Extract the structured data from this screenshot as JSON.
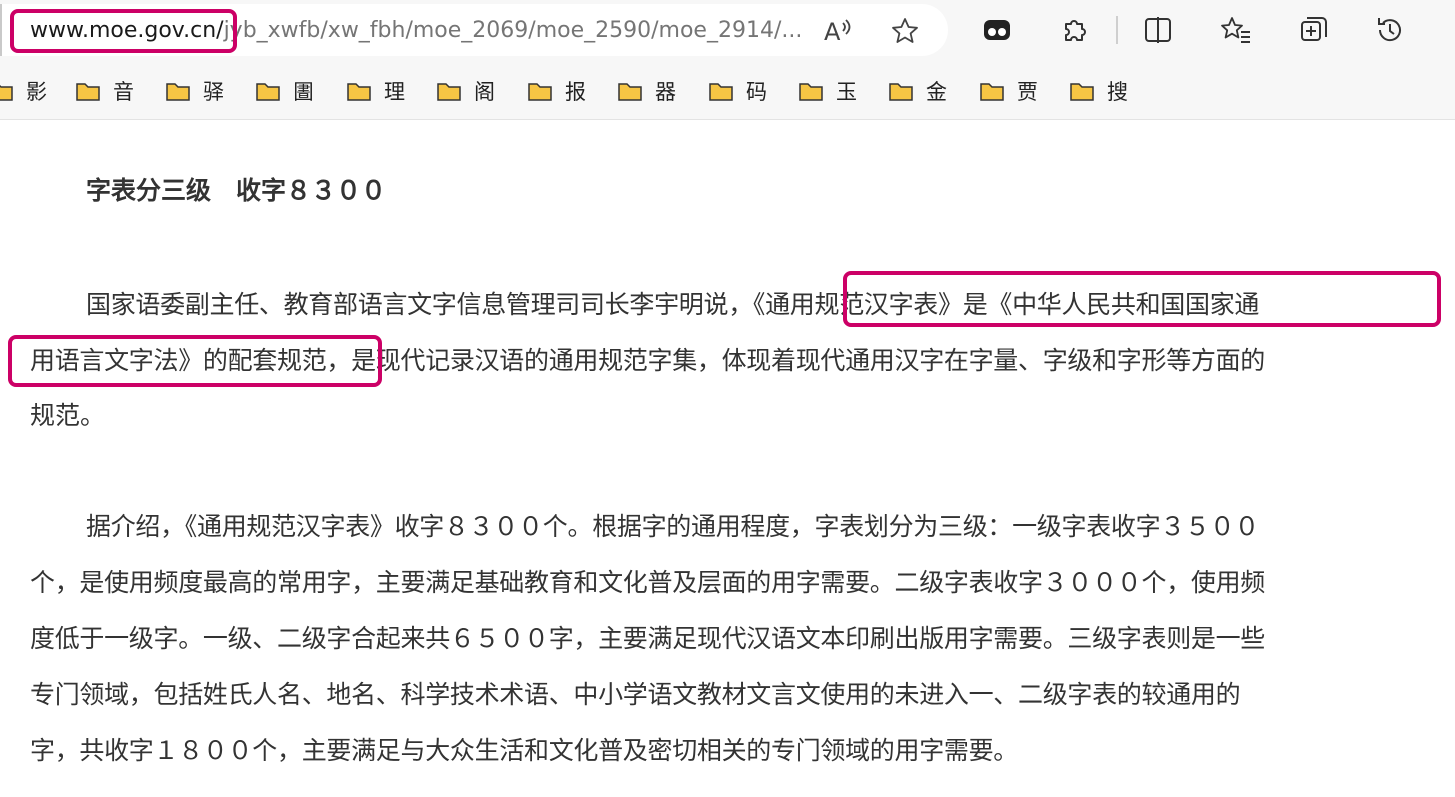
{
  "browser": {
    "url_domain": "www.moe.gov.cn/",
    "url_rest": "jyb_xwfb/xw_fbh/moe_2069/moe_2590/moe_2914/...",
    "toolbar_icons": [
      "read-aloud-icon",
      "favorite-star-icon",
      "games-icon",
      "extensions-icon",
      "split-screen-icon",
      "favorites-icon",
      "collections-icon",
      "history-icon"
    ]
  },
  "bookmarks": [
    {
      "label": "影"
    },
    {
      "label": "音"
    },
    {
      "label": "驿"
    },
    {
      "label": "圕"
    },
    {
      "label": "理"
    },
    {
      "label": "阁"
    },
    {
      "label": "报"
    },
    {
      "label": "器"
    },
    {
      "label": "码"
    },
    {
      "label": "玉"
    },
    {
      "label": "金"
    },
    {
      "label": "贾"
    },
    {
      "label": "搜"
    }
  ],
  "article": {
    "heading": "字表分三级　收字８３００",
    "p1": {
      "line1": "国家语委副主任、教育部语言文字信息管理司司长李宇明说，《通用规范汉字表》是《中华人民共和国国家通",
      "line2": "用语言文字法》的配套规范，是现代记录汉语的通用规范字集，体现着现代通用汉字在字量、字级和字形等方面的",
      "line3": "规范。"
    },
    "p2": {
      "line1": "据介绍，《通用规范汉字表》收字８３００个。根据字的通用程度，字表划分为三级：一级字表收字３５００",
      "line2": "个，是使用频度最高的常用字，主要满足基础教育和文化普及层面的用字需要。二级字表收字３０００个，使用频",
      "line3": "度低于一级字。一级、二级字合起来共６５００字，主要满足现代汉语文本印刷出版用字需要。三级字表则是一些",
      "line4": "专门领域，包括姓氏人名、地名、科学技术术语、中小学语文教材文言文使用的未进入一、二级字表的较通用的",
      "line5": "字，共收字１８００个，主要满足与大众生活和文化普及密切相关的专门领域的用字需要。"
    }
  },
  "colors": {
    "highlight": "#cc0066",
    "folder": "#f6c544"
  }
}
